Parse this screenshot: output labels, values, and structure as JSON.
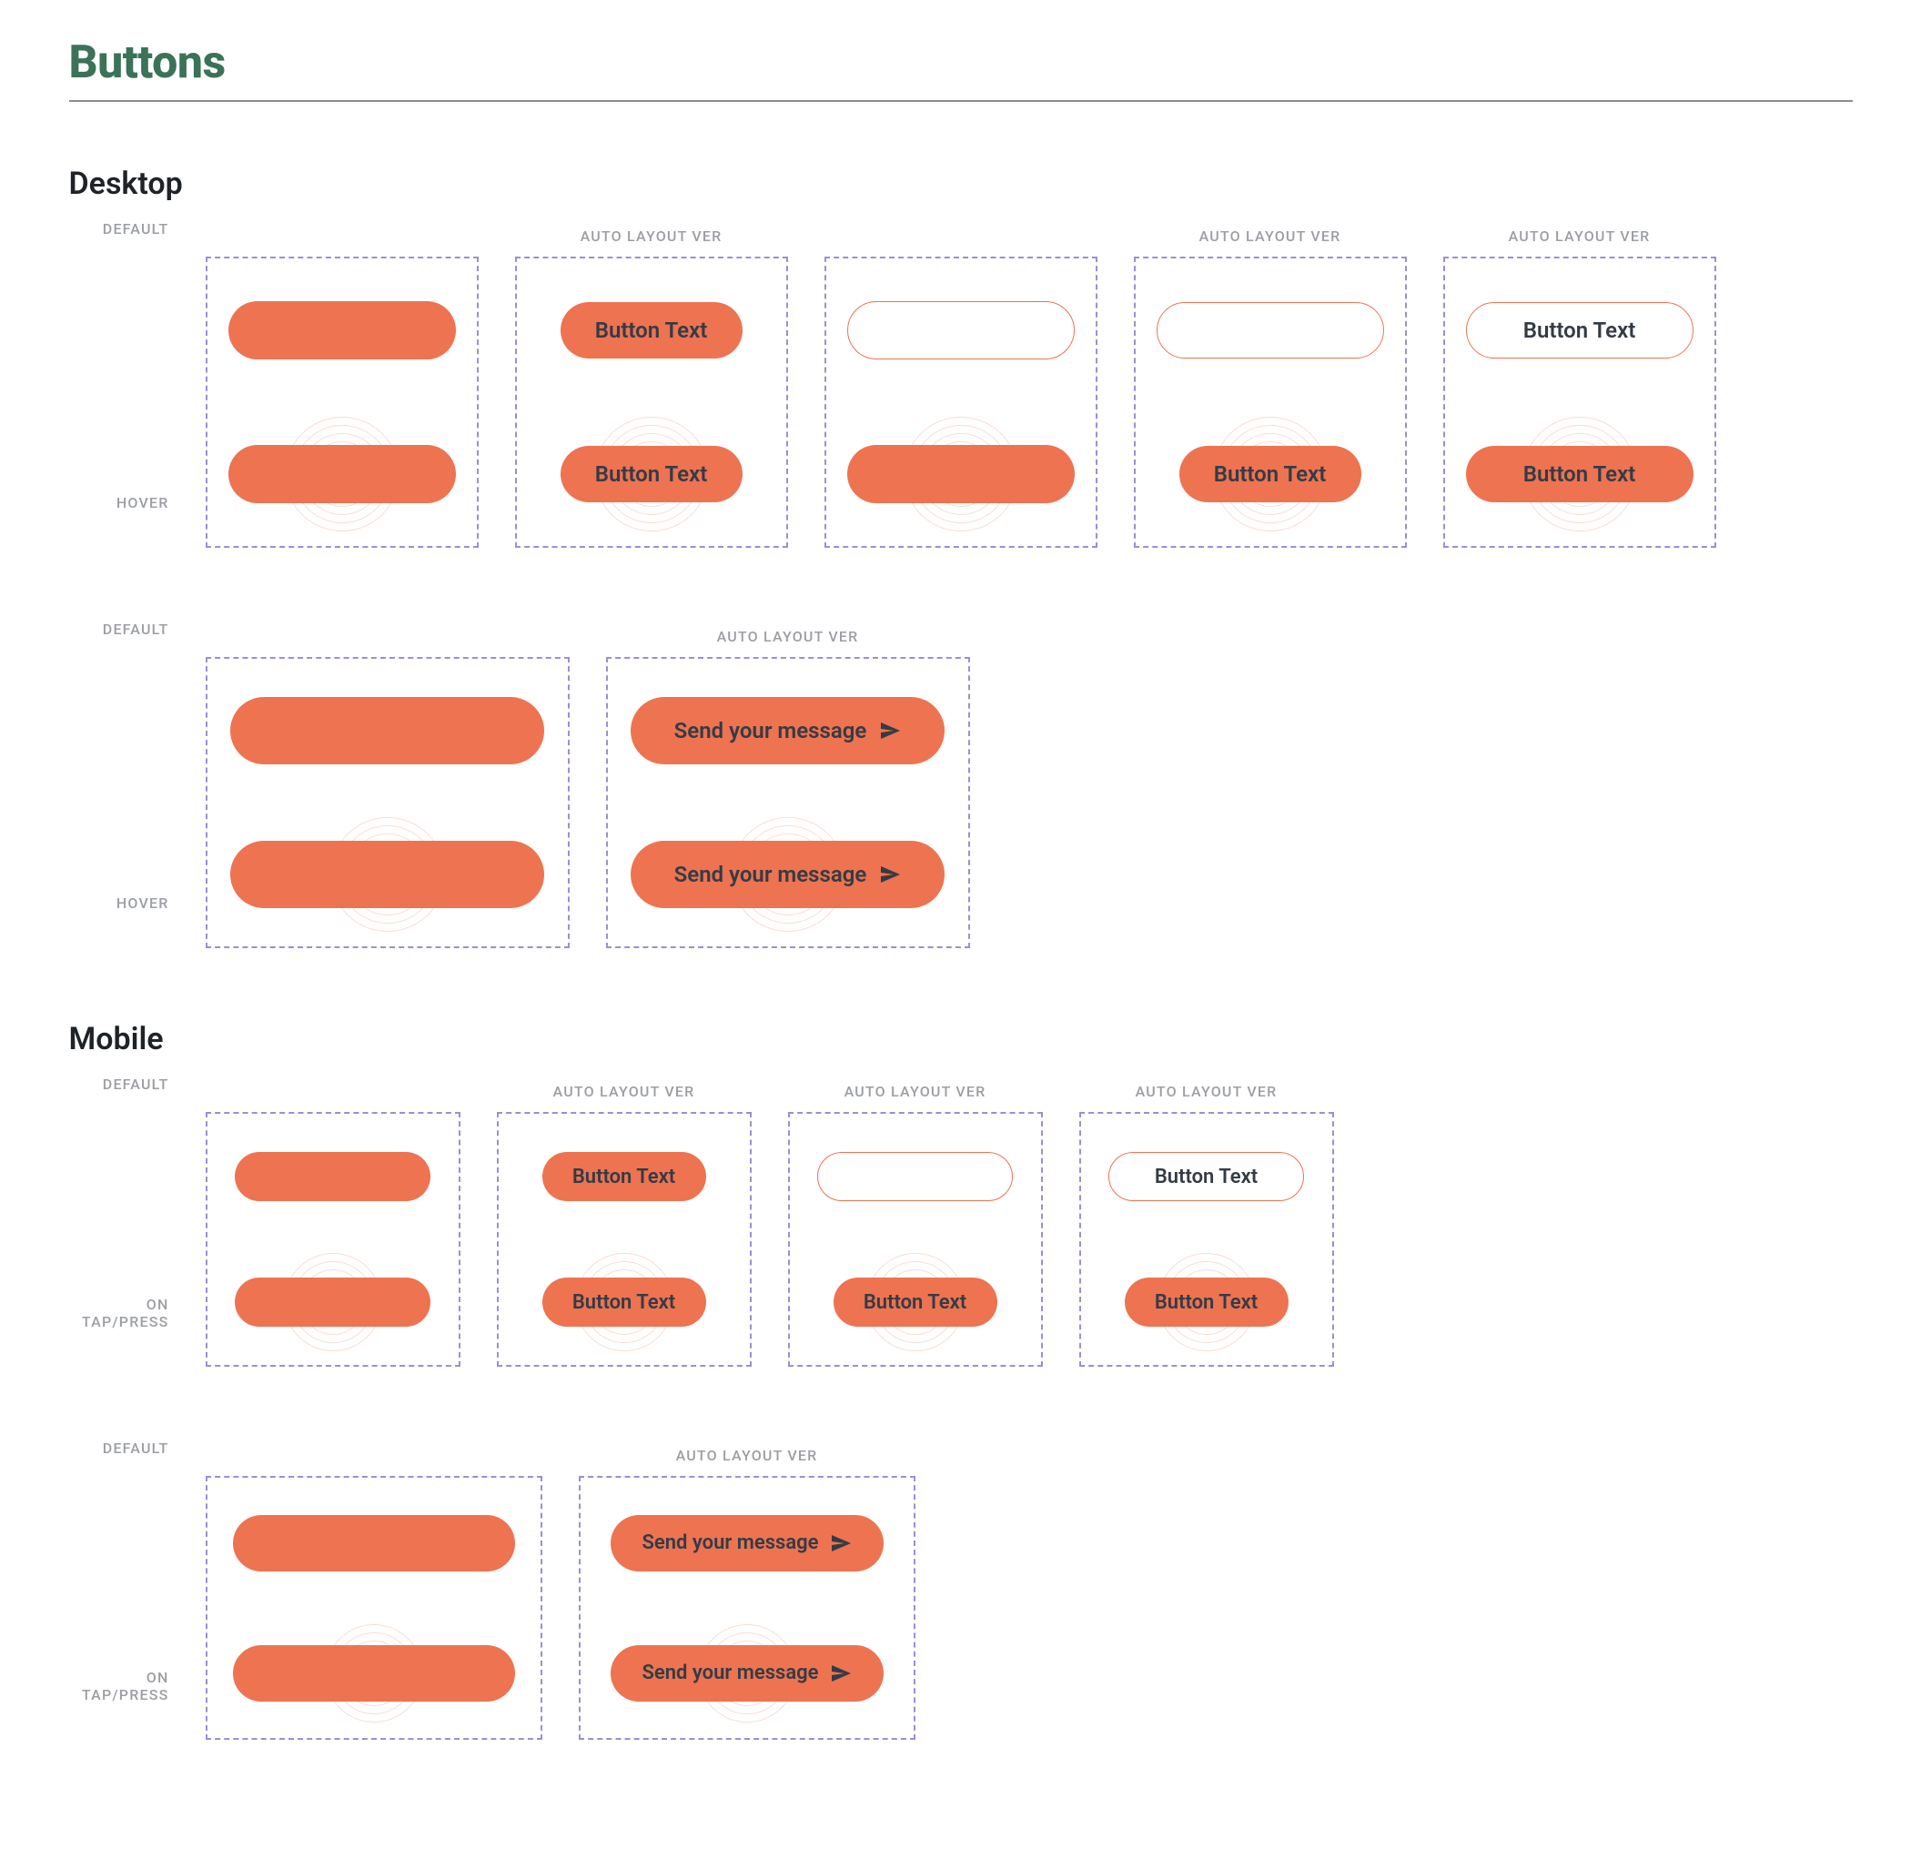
{
  "page": {
    "title": "Buttons"
  },
  "labels": {
    "auto_layout": "AUTO LAYOUT VER",
    "default": "DEFAULT",
    "hover": "HOVER",
    "on_tap": "ON TAP/PRESS"
  },
  "sections": {
    "desktop": {
      "title": "Desktop"
    },
    "mobile": {
      "title": "Mobile"
    }
  },
  "buttons": {
    "generic": "Button Text",
    "send": "Send your message"
  },
  "colors": {
    "accent": "#ed7351",
    "title": "#3a7358",
    "dash": "#9a8fd6"
  }
}
